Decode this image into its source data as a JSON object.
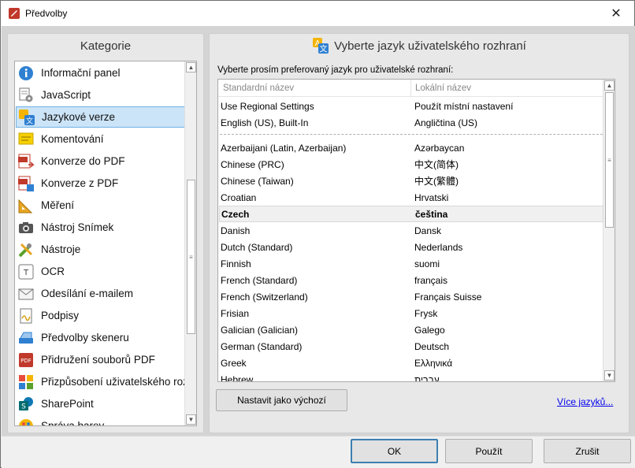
{
  "window": {
    "title": "Předvolby",
    "close_label": "✕"
  },
  "left": {
    "header": "Kategorie",
    "items": [
      {
        "label": "Informační panel",
        "icon": "info-icon"
      },
      {
        "label": "JavaScript",
        "icon": "script-gear-icon"
      },
      {
        "label": "Jazykové verze",
        "icon": "language-icon",
        "selected": true
      },
      {
        "label": "Komentování",
        "icon": "comment-icon"
      },
      {
        "label": "Konverze do PDF",
        "icon": "pdf-convert-icon"
      },
      {
        "label": "Konverze z PDF",
        "icon": "pdf-export-icon"
      },
      {
        "label": "Měření",
        "icon": "ruler-icon"
      },
      {
        "label": "Nástroj Snímek",
        "icon": "camera-icon"
      },
      {
        "label": "Nástroje",
        "icon": "tools-icon"
      },
      {
        "label": "OCR",
        "icon": "ocr-icon"
      },
      {
        "label": "Odesílání e-mailem",
        "icon": "envelope-icon"
      },
      {
        "label": "Podpisy",
        "icon": "signature-icon"
      },
      {
        "label": "Předvolby skeneru",
        "icon": "scanner-icon"
      },
      {
        "label": "Přidružení souborů PDF",
        "icon": "pdf-file-icon"
      },
      {
        "label": "Přizpůsobení uživatelského roz",
        "icon": "customize-icon"
      },
      {
        "label": "SharePoint",
        "icon": "sharepoint-icon"
      },
      {
        "label": "Správa barev",
        "icon": "color-icon"
      }
    ]
  },
  "right": {
    "header": "Vyberte jazyk uživatelského rozhraní",
    "prompt": "Vyberte prosím preferovaný jazyk pro uživatelské rozhraní:",
    "columns": {
      "standard": "Standardní název",
      "local": "Lokální název"
    },
    "top_rows": [
      {
        "std": "Use Regional Settings",
        "loc": "Použít místní nastavení"
      },
      {
        "std": "English (US), Built-In",
        "loc": "Angličtina (US)"
      }
    ],
    "rows": [
      {
        "std": "Azerbaijani (Latin, Azerbaijan)",
        "loc": "Azərbaycan"
      },
      {
        "std": "Chinese (PRC)",
        "loc": "中文(简体)"
      },
      {
        "std": "Chinese (Taiwan)",
        "loc": "中文(繁體)"
      },
      {
        "std": "Croatian",
        "loc": "Hrvatski"
      },
      {
        "std": "Czech",
        "loc": "čeština",
        "selected": true
      },
      {
        "std": "Danish",
        "loc": "Dansk"
      },
      {
        "std": "Dutch (Standard)",
        "loc": "Nederlands"
      },
      {
        "std": "Finnish",
        "loc": "suomi"
      },
      {
        "std": "French (Standard)",
        "loc": "français"
      },
      {
        "std": "French (Switzerland)",
        "loc": "Français Suisse"
      },
      {
        "std": "Frisian",
        "loc": "Frysk"
      },
      {
        "std": "Galician (Galician)",
        "loc": "Galego"
      },
      {
        "std": "German (Standard)",
        "loc": "Deutsch"
      },
      {
        "std": "Greek",
        "loc": "Ελληνικά"
      },
      {
        "std": "Hebrew",
        "loc": "עברית"
      }
    ],
    "set_default_label": "Nastavit jako výchozí",
    "more_languages_label": "Více jazyků..."
  },
  "footer": {
    "ok_label": "OK",
    "apply_label": "Použít",
    "cancel_label": "Zrušit"
  },
  "colors": {
    "selection": "#cce4f7",
    "selection_border": "#6fb1e6",
    "link": "#0000ee",
    "default_button_border": "#3c7fb1"
  }
}
